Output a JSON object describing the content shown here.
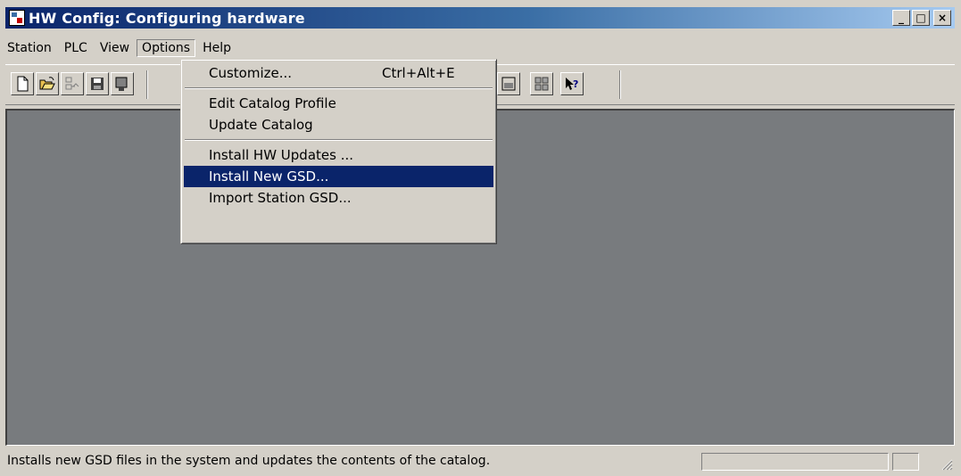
{
  "window": {
    "title": "HW Config: Configuring hardware",
    "minimize_glyph": "_",
    "maximize_glyph": "□",
    "close_glyph": "×"
  },
  "menubar": {
    "items": [
      "Station",
      "PLC",
      "View",
      "Options",
      "Help"
    ],
    "open_item": "Options"
  },
  "toolbar": {
    "buttons": [
      "new-icon",
      "open-icon",
      "network-icon",
      "save-icon",
      "compile-icon",
      "module-icon",
      "catalog-icon",
      "help-cursor-icon"
    ]
  },
  "options_menu": {
    "items": [
      {
        "label": "Customize...",
        "shortcut": "Ctrl+Alt+E"
      },
      {
        "label": "Edit Catalog Profile"
      },
      {
        "label": "Update Catalog"
      },
      {
        "label": "Install HW Updates ..."
      },
      {
        "label": "Install New GSD..."
      },
      {
        "label": "Import Station GSD..."
      }
    ],
    "highlighted": "Install New GSD..."
  },
  "statusbar": {
    "message": "Installs new GSD files in the system and updates the contents of the catalog."
  },
  "colors": {
    "titlebar_start": "#0a246a",
    "workspace": "#787b7e",
    "highlight": "#0a246a",
    "face": "#d4d0c8"
  }
}
